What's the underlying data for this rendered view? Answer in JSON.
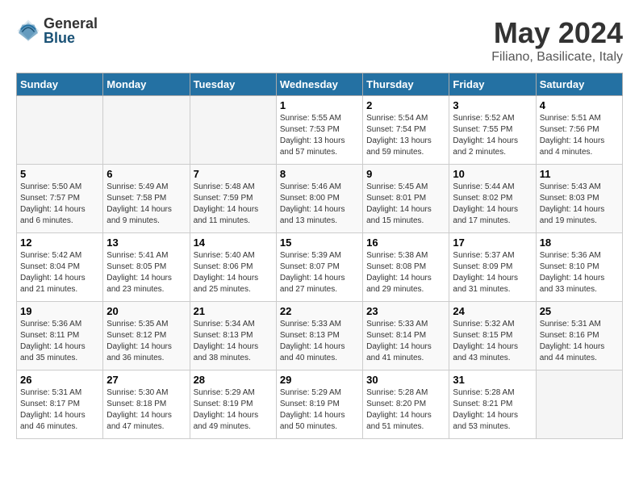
{
  "logo": {
    "general": "General",
    "blue": "Blue"
  },
  "title": "May 2024",
  "location": "Filiano, Basilicate, Italy",
  "days_of_week": [
    "Sunday",
    "Monday",
    "Tuesday",
    "Wednesday",
    "Thursday",
    "Friday",
    "Saturday"
  ],
  "weeks": [
    [
      {
        "num": "",
        "info": ""
      },
      {
        "num": "",
        "info": ""
      },
      {
        "num": "",
        "info": ""
      },
      {
        "num": "1",
        "info": "Sunrise: 5:55 AM\nSunset: 7:53 PM\nDaylight: 13 hours\nand 57 minutes."
      },
      {
        "num": "2",
        "info": "Sunrise: 5:54 AM\nSunset: 7:54 PM\nDaylight: 13 hours\nand 59 minutes."
      },
      {
        "num": "3",
        "info": "Sunrise: 5:52 AM\nSunset: 7:55 PM\nDaylight: 14 hours\nand 2 minutes."
      },
      {
        "num": "4",
        "info": "Sunrise: 5:51 AM\nSunset: 7:56 PM\nDaylight: 14 hours\nand 4 minutes."
      }
    ],
    [
      {
        "num": "5",
        "info": "Sunrise: 5:50 AM\nSunset: 7:57 PM\nDaylight: 14 hours\nand 6 minutes."
      },
      {
        "num": "6",
        "info": "Sunrise: 5:49 AM\nSunset: 7:58 PM\nDaylight: 14 hours\nand 9 minutes."
      },
      {
        "num": "7",
        "info": "Sunrise: 5:48 AM\nSunset: 7:59 PM\nDaylight: 14 hours\nand 11 minutes."
      },
      {
        "num": "8",
        "info": "Sunrise: 5:46 AM\nSunset: 8:00 PM\nDaylight: 14 hours\nand 13 minutes."
      },
      {
        "num": "9",
        "info": "Sunrise: 5:45 AM\nSunset: 8:01 PM\nDaylight: 14 hours\nand 15 minutes."
      },
      {
        "num": "10",
        "info": "Sunrise: 5:44 AM\nSunset: 8:02 PM\nDaylight: 14 hours\nand 17 minutes."
      },
      {
        "num": "11",
        "info": "Sunrise: 5:43 AM\nSunset: 8:03 PM\nDaylight: 14 hours\nand 19 minutes."
      }
    ],
    [
      {
        "num": "12",
        "info": "Sunrise: 5:42 AM\nSunset: 8:04 PM\nDaylight: 14 hours\nand 21 minutes."
      },
      {
        "num": "13",
        "info": "Sunrise: 5:41 AM\nSunset: 8:05 PM\nDaylight: 14 hours\nand 23 minutes."
      },
      {
        "num": "14",
        "info": "Sunrise: 5:40 AM\nSunset: 8:06 PM\nDaylight: 14 hours\nand 25 minutes."
      },
      {
        "num": "15",
        "info": "Sunrise: 5:39 AM\nSunset: 8:07 PM\nDaylight: 14 hours\nand 27 minutes."
      },
      {
        "num": "16",
        "info": "Sunrise: 5:38 AM\nSunset: 8:08 PM\nDaylight: 14 hours\nand 29 minutes."
      },
      {
        "num": "17",
        "info": "Sunrise: 5:37 AM\nSunset: 8:09 PM\nDaylight: 14 hours\nand 31 minutes."
      },
      {
        "num": "18",
        "info": "Sunrise: 5:36 AM\nSunset: 8:10 PM\nDaylight: 14 hours\nand 33 minutes."
      }
    ],
    [
      {
        "num": "19",
        "info": "Sunrise: 5:36 AM\nSunset: 8:11 PM\nDaylight: 14 hours\nand 35 minutes."
      },
      {
        "num": "20",
        "info": "Sunrise: 5:35 AM\nSunset: 8:12 PM\nDaylight: 14 hours\nand 36 minutes."
      },
      {
        "num": "21",
        "info": "Sunrise: 5:34 AM\nSunset: 8:13 PM\nDaylight: 14 hours\nand 38 minutes."
      },
      {
        "num": "22",
        "info": "Sunrise: 5:33 AM\nSunset: 8:13 PM\nDaylight: 14 hours\nand 40 minutes."
      },
      {
        "num": "23",
        "info": "Sunrise: 5:33 AM\nSunset: 8:14 PM\nDaylight: 14 hours\nand 41 minutes."
      },
      {
        "num": "24",
        "info": "Sunrise: 5:32 AM\nSunset: 8:15 PM\nDaylight: 14 hours\nand 43 minutes."
      },
      {
        "num": "25",
        "info": "Sunrise: 5:31 AM\nSunset: 8:16 PM\nDaylight: 14 hours\nand 44 minutes."
      }
    ],
    [
      {
        "num": "26",
        "info": "Sunrise: 5:31 AM\nSunset: 8:17 PM\nDaylight: 14 hours\nand 46 minutes."
      },
      {
        "num": "27",
        "info": "Sunrise: 5:30 AM\nSunset: 8:18 PM\nDaylight: 14 hours\nand 47 minutes."
      },
      {
        "num": "28",
        "info": "Sunrise: 5:29 AM\nSunset: 8:19 PM\nDaylight: 14 hours\nand 49 minutes."
      },
      {
        "num": "29",
        "info": "Sunrise: 5:29 AM\nSunset: 8:19 PM\nDaylight: 14 hours\nand 50 minutes."
      },
      {
        "num": "30",
        "info": "Sunrise: 5:28 AM\nSunset: 8:20 PM\nDaylight: 14 hours\nand 51 minutes."
      },
      {
        "num": "31",
        "info": "Sunrise: 5:28 AM\nSunset: 8:21 PM\nDaylight: 14 hours\nand 53 minutes."
      },
      {
        "num": "",
        "info": ""
      }
    ]
  ]
}
